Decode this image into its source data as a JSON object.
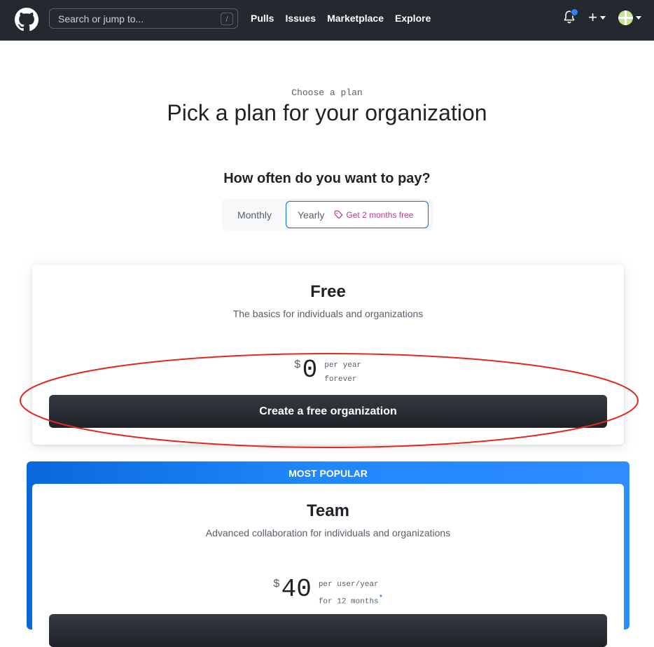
{
  "header": {
    "search_placeholder": "Search or jump to...",
    "search_shortcut": "/",
    "nav": [
      "Pulls",
      "Issues",
      "Marketplace",
      "Explore"
    ],
    "notification_dot_color": "#2f81f7",
    "icons": [
      "github-logo-icon",
      "bell-icon",
      "plus-icon",
      "avatar-icon"
    ]
  },
  "intro": {
    "eyebrow": "Choose a plan",
    "title": "Pick a plan for your organization",
    "question": "How often do you want to pay?"
  },
  "billing_toggle": {
    "monthly_label": "Monthly",
    "yearly_label": "Yearly",
    "yearly_promo": "Get 2 months free",
    "selected": "Yearly"
  },
  "plans": {
    "free": {
      "name": "Free",
      "description": "The basics for individuals and organizations",
      "currency": "$",
      "amount": "0",
      "period_line1": "per year",
      "period_line2": "forever",
      "cta": "Create a free organization"
    },
    "team": {
      "badge": "MOST POPULAR",
      "name": "Team",
      "description": "Advanced collaboration for individuals and organizations",
      "currency": "$",
      "amount": "40",
      "period_line1": "per user/year",
      "period_line2": "for 12 months",
      "footnote_marker": "*"
    }
  },
  "colors": {
    "header_bg": "#24292f",
    "accent_blue": "#0969da",
    "promo_pink": "#bf3989",
    "annotation_red": "#e3261f"
  }
}
